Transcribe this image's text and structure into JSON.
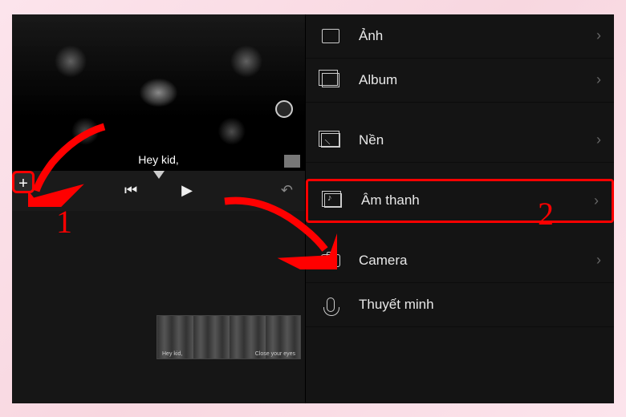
{
  "preview": {
    "caption": "Hey kid,",
    "add_symbol": "+"
  },
  "transport": {
    "prev": "⏮",
    "play": "▶",
    "undo": "↶"
  },
  "clip": {
    "caption_left": "Hey kid,",
    "caption_right": "Close your eyes"
  },
  "menu": {
    "items": [
      {
        "label": "Ảnh"
      },
      {
        "label": "Album"
      },
      {
        "label": "Nền"
      },
      {
        "label": "Âm thanh"
      },
      {
        "label": "Camera"
      },
      {
        "label": "Thuyết minh"
      }
    ],
    "chevron": "›"
  },
  "annotations": {
    "step1": "1",
    "step2": "2"
  }
}
